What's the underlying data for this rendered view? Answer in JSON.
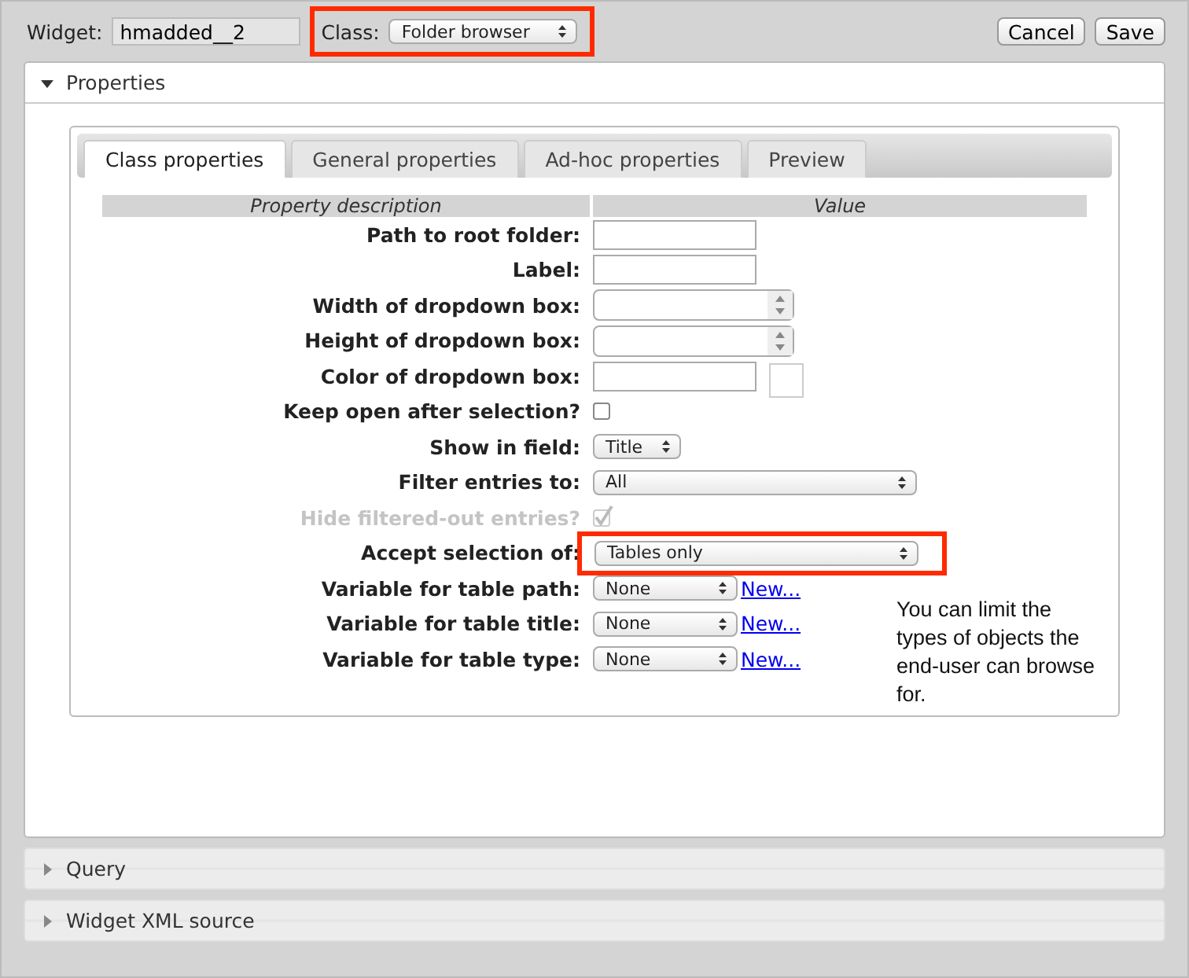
{
  "header": {
    "widget_label": "Widget:",
    "widget_value": "hmadded__2",
    "class_label": "Class:",
    "class_value": "Folder browser",
    "class_highlighted": true,
    "buttons": [
      "Cancel",
      "Save"
    ]
  },
  "sections": [
    {
      "title": "Properties",
      "expanded": true
    },
    {
      "title": "Query",
      "expanded": false
    },
    {
      "title": "Widget XML source",
      "expanded": false
    }
  ],
  "tabs": [
    {
      "label": "Class properties",
      "selected": true
    },
    {
      "label": "General properties",
      "selected": false
    },
    {
      "label": "Ad-hoc properties",
      "selected": false
    },
    {
      "label": "Preview",
      "selected": false
    }
  ],
  "table": {
    "columns": [
      "Property description",
      "Value"
    ],
    "rows": [
      {
        "label": "Path to root folder:",
        "kind": "text"
      },
      {
        "label": "Label:",
        "kind": "text"
      },
      {
        "label": "Width of dropdown box:",
        "kind": "spinner"
      },
      {
        "label": "Height of dropdown box:",
        "kind": "spinner"
      },
      {
        "label": "Color of dropdown box:",
        "kind": "color"
      },
      {
        "label": "Keep open after selection?",
        "kind": "checkbox",
        "checked": false,
        "disabled": false
      },
      {
        "label": "Show in field:",
        "kind": "short_select",
        "value": "Title"
      },
      {
        "label": "Filter entries to:",
        "kind": "select",
        "value": "All"
      },
      {
        "label": "Hide filtered-out entries?",
        "kind": "checkbox",
        "checked": true,
        "disabled": true
      },
      {
        "label": "Accept selection of:",
        "kind": "select",
        "value": "Tables only",
        "highlighted": true
      },
      {
        "label": "Variable for table path:",
        "kind": "select_new",
        "value": "None",
        "link": "New..."
      },
      {
        "label": "Variable for table title:",
        "kind": "select_new",
        "value": "None",
        "link": "New..."
      },
      {
        "label": "Variable for table type:",
        "kind": "select_new",
        "value": "None",
        "link": "New..."
      }
    ]
  },
  "note": "You can limit the types of objects the end-user can browse for."
}
